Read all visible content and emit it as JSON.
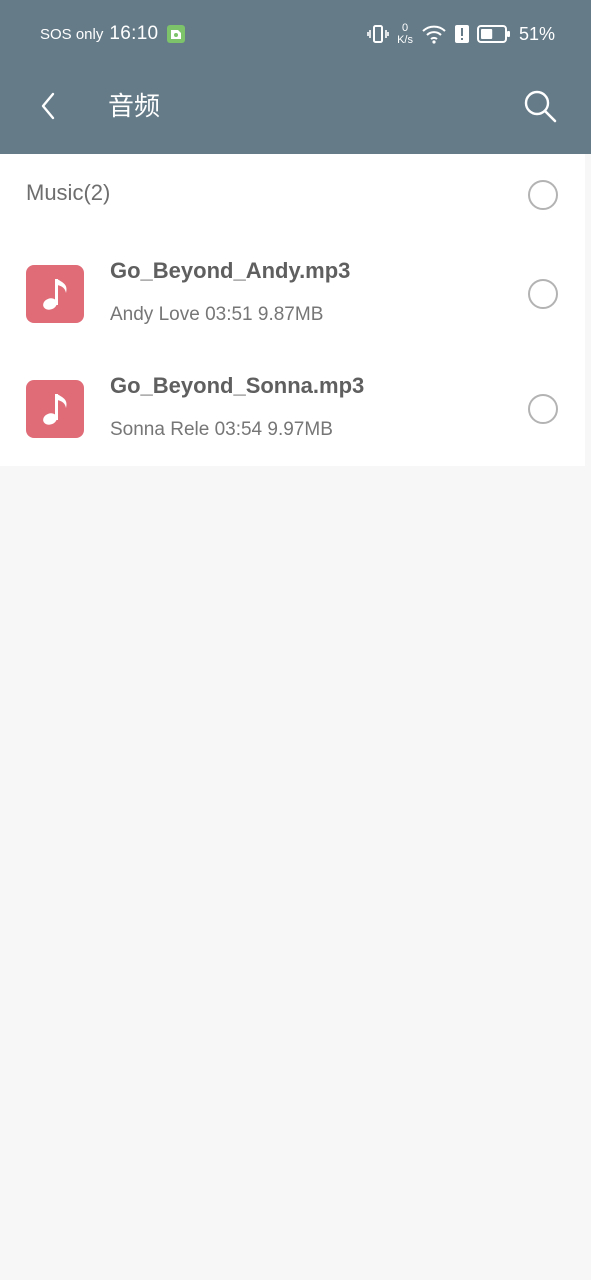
{
  "status_bar": {
    "sos_text": "SOS only",
    "time": "16:10",
    "net_speed_value": "0",
    "net_speed_unit": "K/s",
    "battery_percent": "51%",
    "icons": [
      "vibrate-icon",
      "wifi-icon",
      "alert-icon",
      "battery-icon"
    ],
    "battery_level": 0.51
  },
  "toolbar": {
    "title": "音频",
    "back_icon": "chevron-left-icon",
    "search_icon": "search-icon"
  },
  "group": {
    "title": "Music(2)"
  },
  "files": [
    {
      "name": "Go_Beyond_Andy.mp3",
      "meta": "Andy Love 03:51 9.87MB",
      "icon": "music-note-icon"
    },
    {
      "name": "Go_Beyond_Sonna.mp3",
      "meta": "Sonna Rele 03:54 9.97MB",
      "icon": "music-note-icon"
    }
  ],
  "colors": {
    "header_bg": "#657b88",
    "file_icon_bg": "#e06c78",
    "page_bg": "#f7f7f7"
  }
}
